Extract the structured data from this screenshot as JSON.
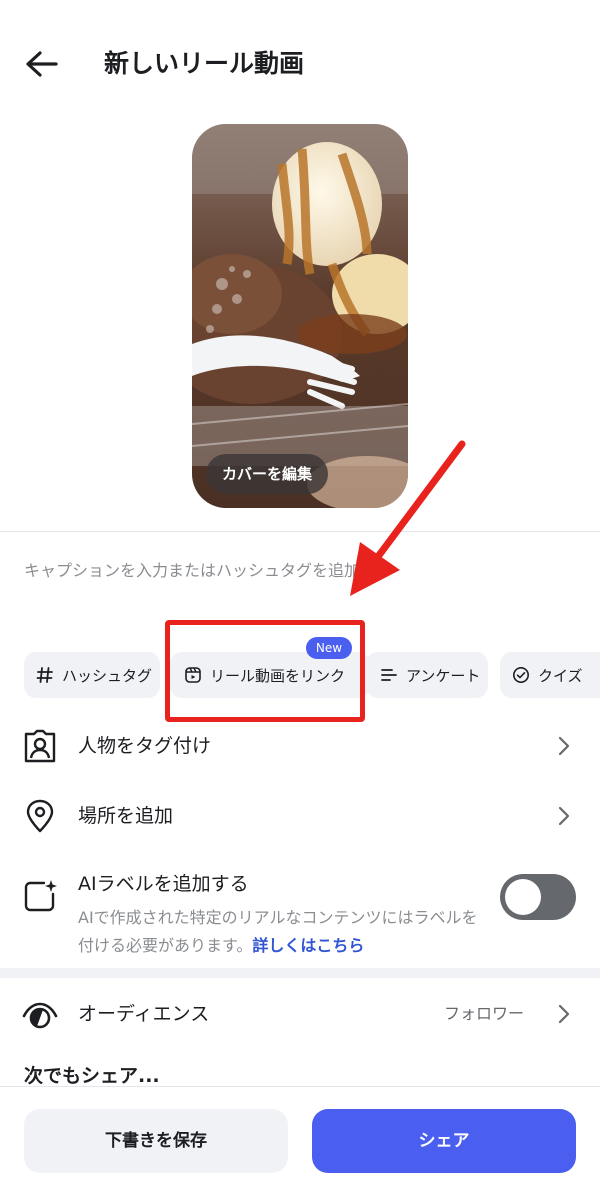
{
  "header": {
    "title": "新しいリール動画"
  },
  "cover": {
    "edit_label": "カバーを編集"
  },
  "caption": {
    "placeholder": "キャプションを入力またはハッシュタグを追加..."
  },
  "chips": {
    "hashtag": "ハッシュタグ",
    "reel_link": "リール動画をリンク",
    "reel_link_badge": "New",
    "poll": "アンケート",
    "quiz": "クイズ"
  },
  "rows": {
    "tag_people": "人物をタグ付け",
    "add_location": "場所を追加",
    "ai_label": {
      "title": "AIラベルを追加する",
      "description": "AIで作成された特定のリアルなコンテンツにはラベルを付ける必要があります。",
      "link": "詳しくはこちら",
      "enabled": false
    },
    "audience": {
      "label": "オーディエンス",
      "value": "フォロワー"
    }
  },
  "share_also": "次でもシェア...",
  "bottom": {
    "draft_label": "下書きを保存",
    "share_label": "シェア"
  },
  "colors": {
    "accent": "#4a5ef0",
    "link": "#2f55d4",
    "annotation_red": "#e8231d",
    "toggle_off": "#65686c"
  }
}
